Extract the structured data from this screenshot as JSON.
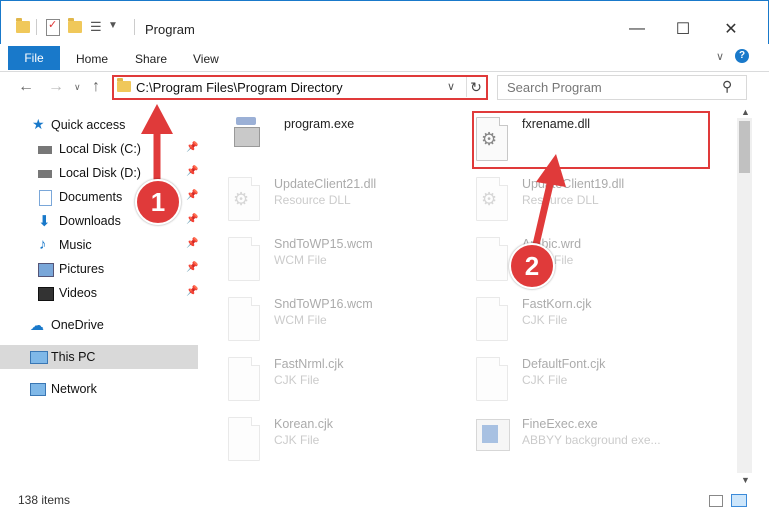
{
  "window": {
    "title": "Program"
  },
  "ribbon": {
    "file": "File",
    "tabs": [
      "Home",
      "Share",
      "View"
    ]
  },
  "address": {
    "path": "C:\\Program Files\\Program Directory"
  },
  "search": {
    "placeholder": "Search Program"
  },
  "nav": {
    "quick_access": "Quick access",
    "items": [
      "Local Disk (C:)",
      "Local Disk (D:)",
      "Documents",
      "Downloads",
      "Music",
      "Pictures",
      "Videos"
    ],
    "onedrive": "OneDrive",
    "this_pc": "This PC",
    "network": "Network"
  },
  "files": [
    {
      "name": "program.exe",
      "type": ""
    },
    {
      "name": "fxrename.dll",
      "type": ""
    },
    {
      "name": "UpdateClient21.dll",
      "type": "Resource DLL"
    },
    {
      "name": "UpdateClient19.dll",
      "type": "Resource DLL"
    },
    {
      "name": "SndToWP15.wcm",
      "type": "WCM File"
    },
    {
      "name": "Arabic.wrd",
      "type": "WRD File"
    },
    {
      "name": "SndToWP16.wcm",
      "type": "WCM File"
    },
    {
      "name": "FastKorn.cjk",
      "type": "CJK File"
    },
    {
      "name": "FastNrml.cjk",
      "type": "CJK File"
    },
    {
      "name": "DefaultFont.cjk",
      "type": "CJK File"
    },
    {
      "name": "Korean.cjk",
      "type": "CJK File"
    },
    {
      "name": "FineExec.exe",
      "type": "ABBYY background exe..."
    }
  ],
  "status": {
    "count": "138 items"
  },
  "annotations": {
    "step1": "1",
    "step2": "2"
  },
  "colors": {
    "accent": "#1979ca",
    "annotation": "#e03a3a"
  }
}
